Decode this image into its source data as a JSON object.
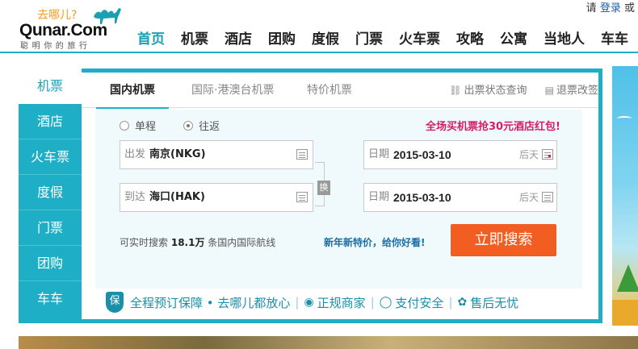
{
  "header": {
    "logo_slogan": "去哪儿?",
    "logo_brand": "Qunar.Com",
    "logo_tagline": "聪明你的旅行",
    "login_prefix": "请",
    "login_link": "登录",
    "login_suffix": "或",
    "nav": [
      {
        "label": "首页",
        "active": true
      },
      {
        "label": "机票",
        "active": false
      },
      {
        "label": "酒店",
        "active": false
      },
      {
        "label": "团购",
        "active": false
      },
      {
        "label": "度假",
        "active": false
      },
      {
        "label": "门票",
        "active": false
      },
      {
        "label": "火车票",
        "active": false
      },
      {
        "label": "攻略",
        "active": false
      },
      {
        "label": "公寓",
        "active": false
      },
      {
        "label": "当地人",
        "active": false
      },
      {
        "label": "车车",
        "active": false
      }
    ]
  },
  "sidebar": {
    "items": [
      {
        "label": "机票",
        "active": true
      },
      {
        "label": "酒店",
        "active": false
      },
      {
        "label": "火车票",
        "active": false
      },
      {
        "label": "度假",
        "active": false
      },
      {
        "label": "门票",
        "active": false
      },
      {
        "label": "团购",
        "active": false
      },
      {
        "label": "车车",
        "active": false
      }
    ]
  },
  "tabs": {
    "domestic": "国内机票",
    "international": "国际·港澳台机票",
    "special": "特价机票",
    "status_query": "出票状态查询",
    "refund_change": "退票改签"
  },
  "form": {
    "trip_one_way": "单程",
    "trip_round": "往返",
    "selected_trip": "round",
    "promo": "全场买机票抢30元酒店红包!",
    "depart_label": "出发",
    "depart_value": "南京(NKG)",
    "arrive_label": "到达",
    "arrive_value": "海口(HAK)",
    "swap_label": "换",
    "date_label": "日期",
    "date1_value": "2015-03-10",
    "date1_hint": "后天",
    "date2_value": "2015-03-10",
    "date2_hint": "后天",
    "route_prefix": "可实时搜索",
    "route_count": "18.1万",
    "route_suffix": "条国内国际航线",
    "newprice": "新年新特价，给你好看!",
    "search_button": "立即搜索"
  },
  "guarantee": {
    "shield": "保",
    "main": "全程预订保障 • 去哪儿都放心",
    "item1": "正规商家",
    "item2": "支付安全",
    "item3": "售后无忧"
  },
  "colors": {
    "brand_teal": "#1eafc6",
    "search_orange": "#f25d22",
    "promo_pink": "#d41e6b"
  }
}
